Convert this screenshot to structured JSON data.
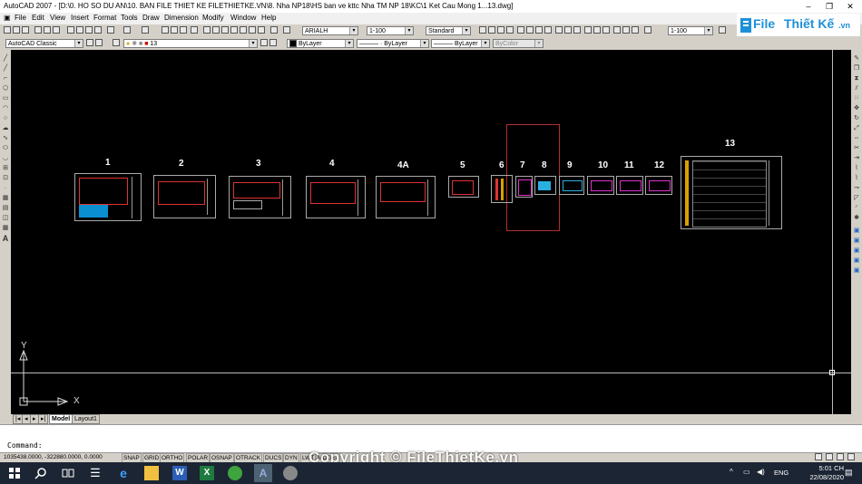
{
  "window": {
    "title": "AutoCAD 2007 - [D:\\0. HO SO DU AN\\10. BAN FILE THIET KE FILETHIETKE.VN\\8. Nha NP18\\HS ban ve kttc Nha TM NP 18\\KC\\1 Ket Cau Mong 1...13.dwg]",
    "minimize": "–",
    "maximize": "❐",
    "close": "✕"
  },
  "menu": [
    "File",
    "Edit",
    "View",
    "Insert",
    "Format",
    "Tools",
    "Draw",
    "Dimension",
    "Modify",
    "Window",
    "Help"
  ],
  "toolbar": {
    "text_style": "ARIALH",
    "dim_scale": "1-100",
    "dim_style": "Standard",
    "table_scale": "1-100"
  },
  "properties": {
    "workspace": "AutoCAD Classic",
    "layer": "13",
    "color": "ByLayer",
    "linetype": "ByLayer",
    "lineweight": "ByLayer",
    "plotstyle": "ByColor"
  },
  "logo": {
    "text_a": "File",
    "text_b": "Thiết Kế",
    "text_c": ".vn"
  },
  "drawing": {
    "sheet_labels": [
      "1",
      "2",
      "3",
      "4",
      "4A",
      "5",
      "6",
      "7",
      "8",
      "9",
      "10",
      "11",
      "12",
      "13"
    ],
    "ucs_y": "Y",
    "ucs_x": "X"
  },
  "tabs": {
    "model": "Model",
    "layout1": "Layout1"
  },
  "command": {
    "prompt": "Command:"
  },
  "status": {
    "coords": "1035438.0000, -322880.0000, 0.0000",
    "buttons": [
      "SNAP",
      "GRID",
      "ORTHO",
      "POLAR",
      "OSNAP",
      "OTRACK",
      "DUCS",
      "DYN",
      "LWT",
      "MODEL"
    ]
  },
  "watermark": "Copyright © FileThietKe.vn",
  "taskbar": {
    "lang": "ENG",
    "time": "5:01 CH",
    "date": "22/08/2020"
  }
}
